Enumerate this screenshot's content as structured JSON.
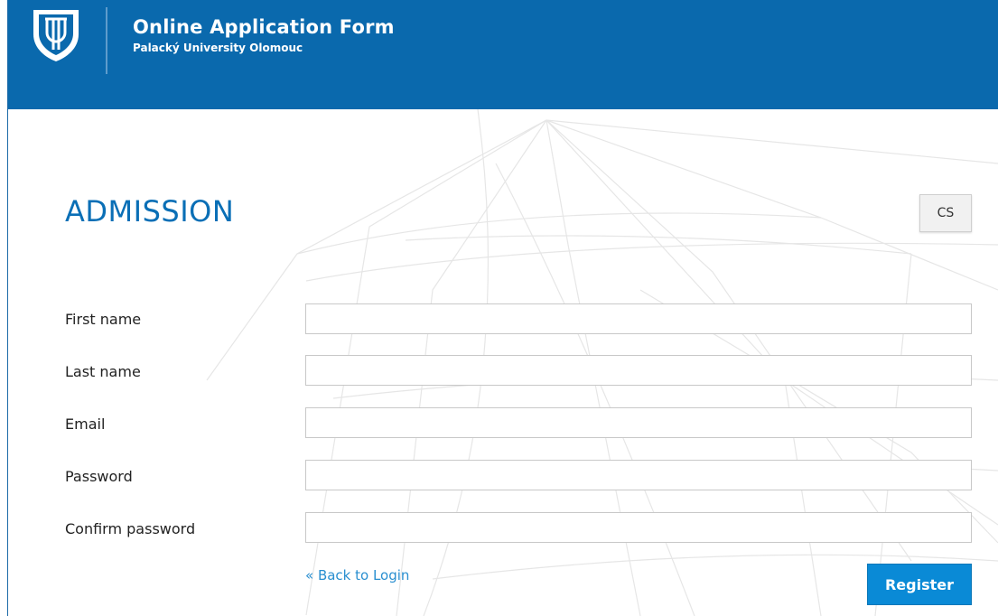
{
  "header": {
    "title": "Online Application Form",
    "subtitle": "Palacký University Olomouc",
    "logo_icon": "university-shield-icon",
    "brand_color": "#0a69ad"
  },
  "page": {
    "title": "ADMISSION",
    "title_color": "#0a6fb6",
    "language_button": "CS"
  },
  "form": {
    "fields": [
      {
        "label": "First name",
        "value": ""
      },
      {
        "label": "Last name",
        "value": ""
      },
      {
        "label": "Email",
        "value": ""
      },
      {
        "label": "Password",
        "value": ""
      },
      {
        "label": "Confirm password",
        "value": ""
      }
    ],
    "back_link": "« Back to Login",
    "submit_label": "Register",
    "submit_color": "#0a8ad6"
  }
}
